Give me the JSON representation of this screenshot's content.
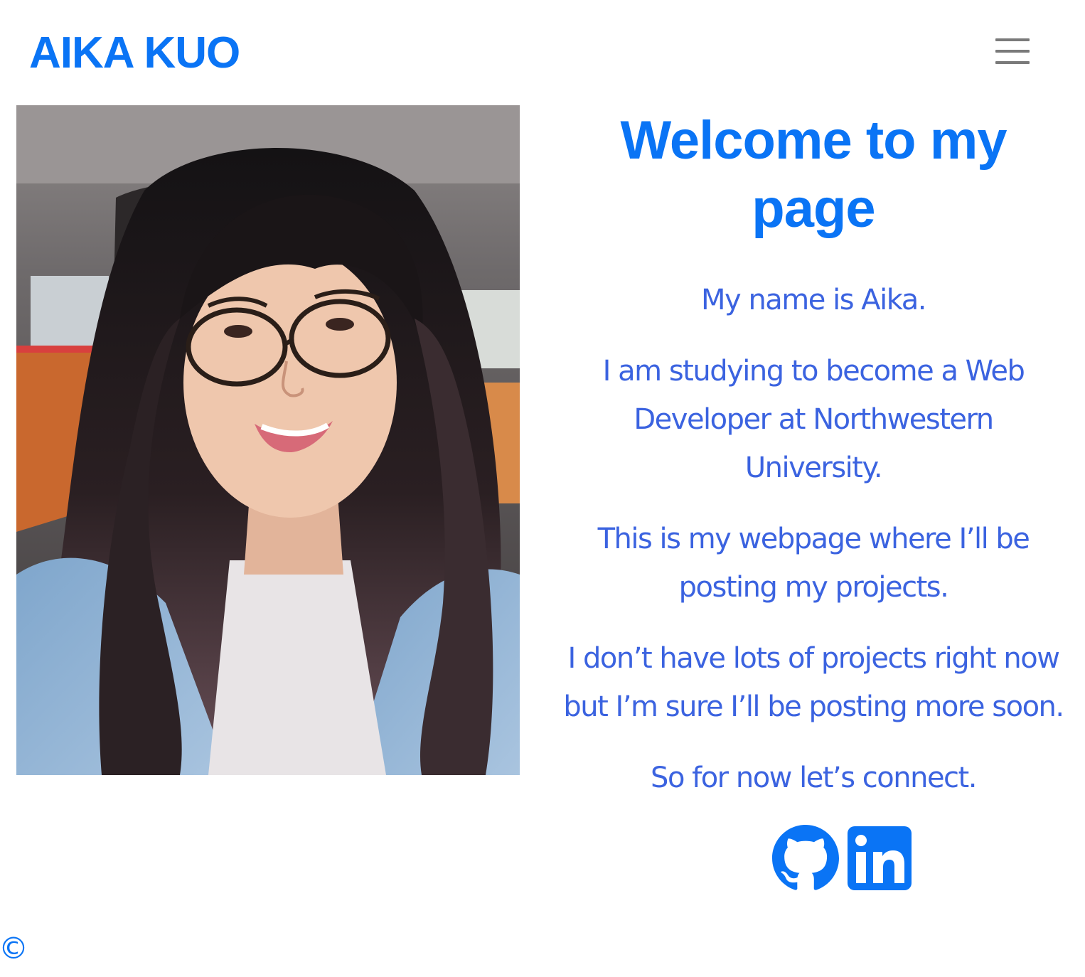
{
  "header": {
    "brand": "AIKA KUO",
    "menu_icon": "hamburger-menu-icon"
  },
  "profile_photo": {
    "alt": "Aika Kuo"
  },
  "intro": {
    "heading": "Welcome to my page",
    "paragraphs": [
      "My name is Aika.",
      "I am studying to become a Web Developer at Northwestern University.",
      "This is my webpage where I’ll be posting my projects.",
      "I don’t have lots of projects right now but I’m sure I’ll be posting more soon.",
      "So for now let’s connect."
    ]
  },
  "social": {
    "links": [
      {
        "icon": "github-icon"
      },
      {
        "icon": "linkedin-icon"
      }
    ]
  },
  "footer": {
    "text": "©"
  },
  "colors": {
    "brand": "#0a74f5",
    "body_text": "#3b63e0",
    "menu": "#7a7a7a"
  }
}
